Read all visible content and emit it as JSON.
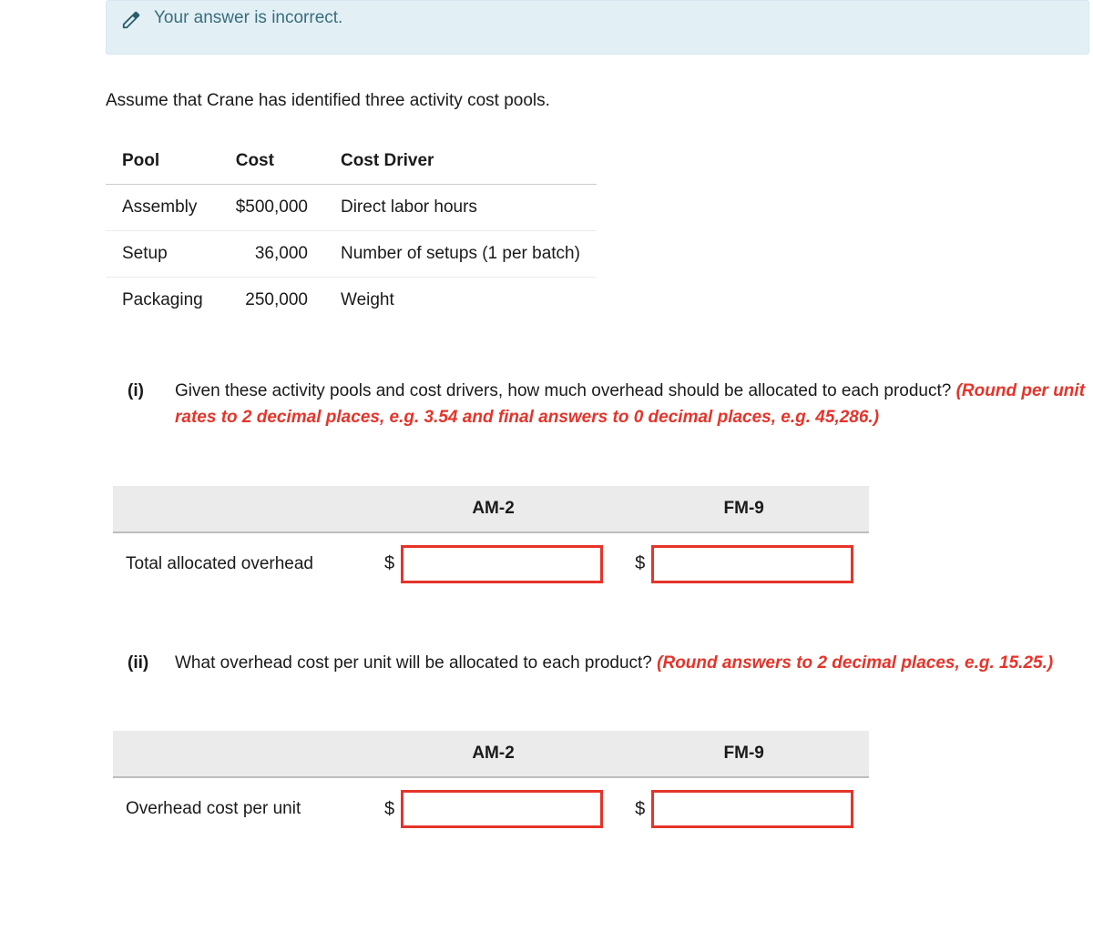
{
  "alert_text": "Your answer is incorrect.",
  "intro": "Assume that Crane has identified three activity cost pools.",
  "cost_table": {
    "headers": {
      "pool": "Pool",
      "cost": "Cost",
      "driver": "Cost Driver"
    },
    "rows": [
      {
        "pool": "Assembly",
        "cost": "$500,000",
        "driver": "Direct labor hours"
      },
      {
        "pool": "Setup",
        "cost": "36,000",
        "driver": "Number of setups (1 per batch)"
      },
      {
        "pool": "Packaging",
        "cost": "250,000",
        "driver": "Weight"
      }
    ]
  },
  "q1": {
    "idx": "(i)",
    "text": "Given these activity pools and cost drivers, how much overhead should be allocated to each product? ",
    "hint": "(Round per unit rates to 2 decimal places, e.g. 3.54 and final answers to 0 decimal places, e.g. 45,286.)"
  },
  "ans1": {
    "col1": "AM-2",
    "col2": "FM-9",
    "rowlabel": "Total allocated overhead",
    "currency": "$",
    "v1": "",
    "v2": ""
  },
  "q2": {
    "idx": "(ii)",
    "text": "What overhead cost per unit will be allocated to each product? ",
    "hint": "(Round answers to 2 decimal places, e.g. 15.25.)"
  },
  "ans2": {
    "col1": "AM-2",
    "col2": "FM-9",
    "rowlabel": "Overhead cost per unit",
    "currency": "$",
    "v1": "",
    "v2": ""
  }
}
